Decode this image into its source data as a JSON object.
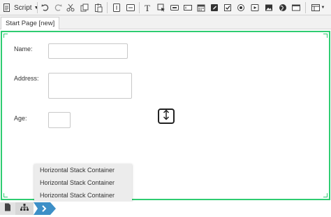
{
  "toolbar": {
    "script_label": "Script",
    "icons": [
      "script-icon",
      "chevron-down-icon",
      "undo-icon",
      "redo-icon",
      "cut-icon",
      "copy-icon",
      "paste-icon",
      "vertical-stack-icon",
      "horizontal-stack-icon",
      "text-icon",
      "cursor-icon",
      "button-icon",
      "input-field-icon",
      "calendar-icon",
      "edit-icon",
      "checkbox-icon",
      "radio-icon",
      "video-icon",
      "image-icon",
      "globe-icon",
      "table-icon",
      "layout-icon"
    ]
  },
  "tabs": [
    {
      "label": "Start Page [new]"
    }
  ],
  "form": {
    "name_label": "Name:",
    "address_label": "Address:",
    "age_label": "Age:"
  },
  "dropdown": {
    "items": [
      "Horizontal Stack Container",
      "Horizontal Stack Container",
      "Horizontal Stack Container"
    ]
  },
  "colors": {
    "accent": "#2ecc71",
    "breadcrumb_active": "#3d8fc7"
  }
}
